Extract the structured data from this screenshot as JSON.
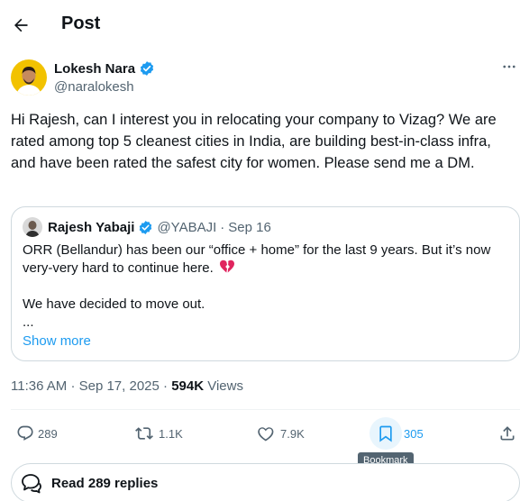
{
  "header": {
    "title": "Post"
  },
  "author": {
    "name": "Lokesh Nara",
    "handle": "@naralokesh",
    "verified": true
  },
  "tweet": {
    "text": "Hi Rajesh, can I interest you in relocating your company to Vizag? We are rated among top 5 cleanest cities in India, are building best-in-class infra, and have been rated the safest city for women. Please send me a DM."
  },
  "quote": {
    "name": "Rajesh Yabaji",
    "handle": "@YABAJI",
    "separator": "·",
    "date": "Sep 16",
    "verified": true,
    "line1": "ORR (Bellandur) has been our “office + home” for the last 9 years. But it’s now",
    "line2": "very-very hard to continue here.",
    "line3": "We have decided to move out.",
    "line4": "...",
    "show_more": "Show more"
  },
  "meta": {
    "time": "11:36 AM",
    "separator": "·",
    "date": "Sep 17, 2025",
    "views_count": "594K",
    "views_label": "Views"
  },
  "actions": {
    "replies": "289",
    "reposts": "1.1K",
    "likes": "7.9K",
    "bookmarks": "305"
  },
  "tooltip": {
    "text": "Bookmark"
  },
  "replies_button": {
    "label": "Read 289 replies"
  },
  "icons": {
    "back": "arrow-left-icon",
    "verified": "verified-badge-icon",
    "more": "more-dots-icon",
    "reply": "reply-icon",
    "repost": "repost-icon",
    "like": "heart-icon",
    "bookmark": "bookmark-icon",
    "share": "share-icon",
    "broken_heart": "broken-heart-icon",
    "chat": "chat-bubbles-icon"
  },
  "colors": {
    "accent": "#1d9bf0",
    "text": "#0f1419",
    "muted": "#536471",
    "border": "#cfd9de",
    "broken_heart": "#e0245e"
  }
}
